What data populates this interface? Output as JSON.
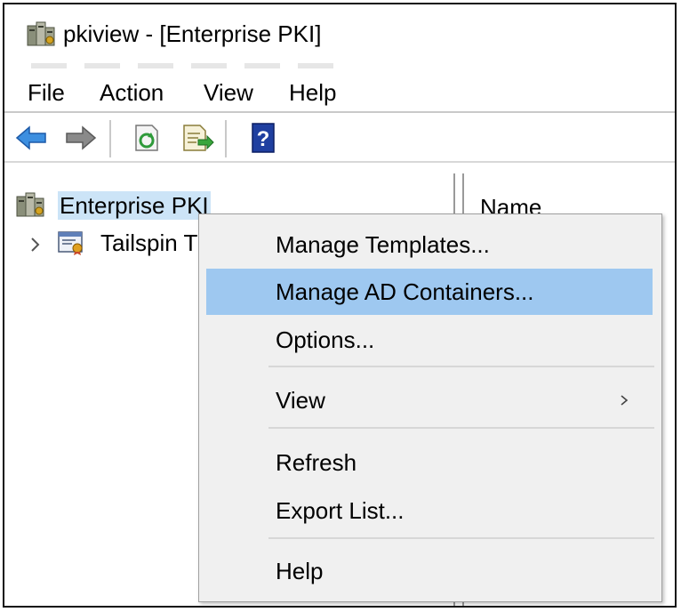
{
  "window": {
    "title": "pkiview - [Enterprise PKI]"
  },
  "menubar": {
    "items": [
      "File",
      "Action",
      "View",
      "Help"
    ]
  },
  "toolbar": {
    "buttons": [
      "back-arrow-icon",
      "forward-arrow-icon",
      "refresh-icon",
      "export-list-icon",
      "help-icon"
    ]
  },
  "tree": {
    "root": {
      "label": "Enterprise PKI",
      "icon": "enterprise-pki-icon"
    },
    "child": {
      "label": "Tailspin T",
      "icon": "certificate-authority-icon"
    }
  },
  "list": {
    "column_header": "Name"
  },
  "context_menu": {
    "highlighted_item": "Manage AD Containers...",
    "items": [
      {
        "label": "Manage Templates..."
      },
      {
        "label": "Manage AD Containers..."
      },
      {
        "label": "Options..."
      },
      {
        "label": "View",
        "submenu": true
      },
      {
        "label": "Refresh"
      },
      {
        "label": "Export List..."
      },
      {
        "label": "Help"
      }
    ]
  },
  "colors": {
    "highlight": "#9ec8f0",
    "selection": "#cce4f7",
    "menu_background": "#f0f0f0",
    "help_icon": "#1f3fa0"
  }
}
